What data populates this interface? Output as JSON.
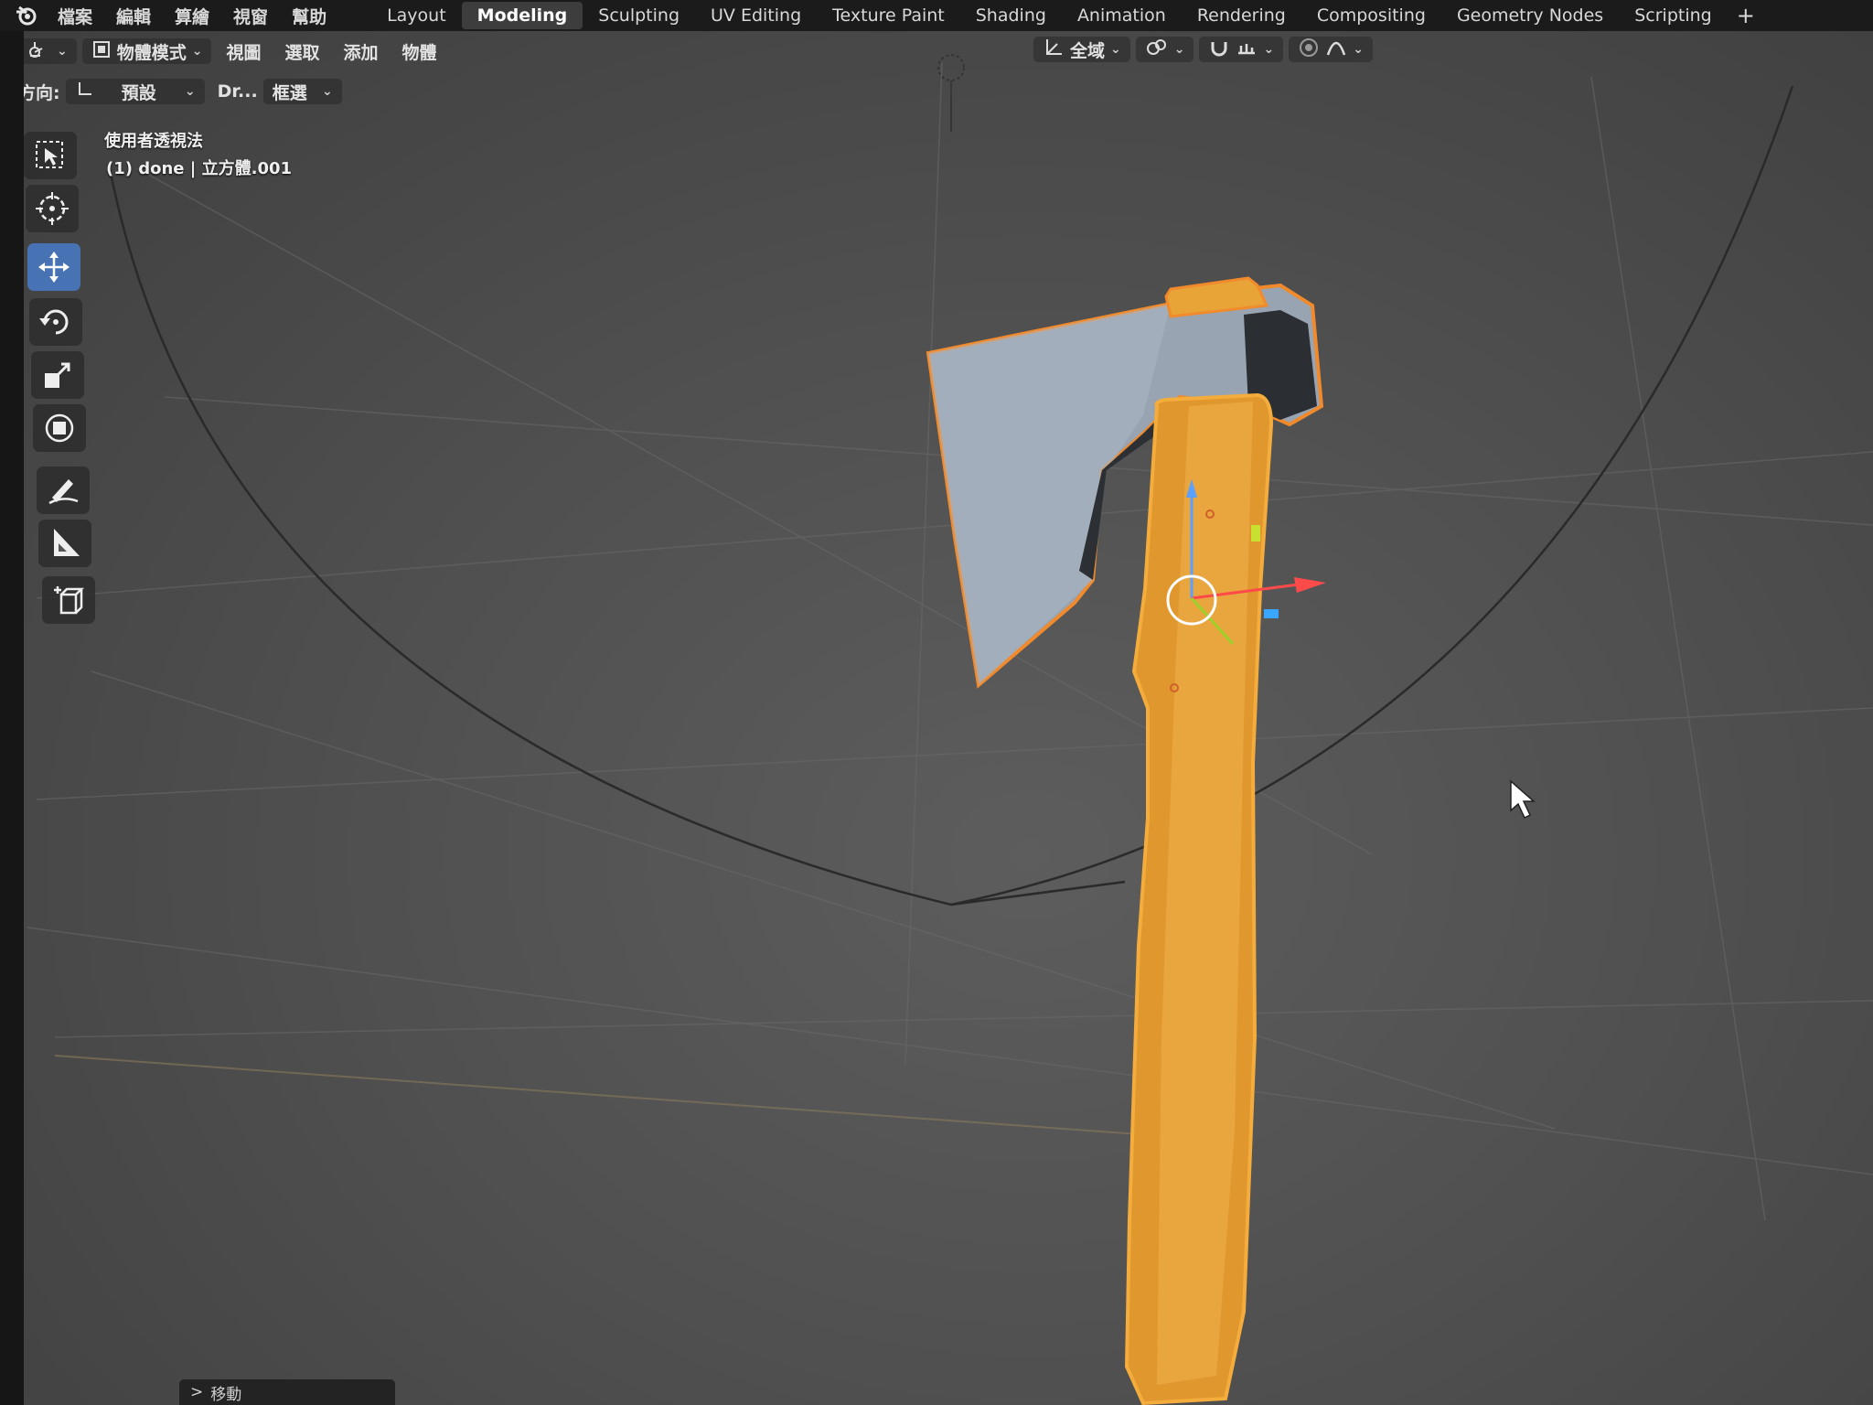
{
  "topbar": {
    "menus": [
      "檔案",
      "編輯",
      "算繪",
      "視窗",
      "幫助"
    ],
    "tabs": [
      "Layout",
      "Modeling",
      "Sculpting",
      "UV Editing",
      "Texture Paint",
      "Shading",
      "Animation",
      "Rendering",
      "Compositing",
      "Geometry Nodes",
      "Scripting"
    ],
    "active_tab": "Modeling",
    "add_tab": "+"
  },
  "viewport_header": {
    "mode": "物體模式",
    "menus": [
      "視圖",
      "選取",
      "添加",
      "物體"
    ],
    "transform_orientation": "全域"
  },
  "tool_settings": {
    "orientation_label": "方向:",
    "orientation_value": "預設",
    "drag_label": "Dr...",
    "select_mode": "框選"
  },
  "overlay": {
    "view_name": "使用者透視法",
    "object_info": "(1) done | 立方體.001"
  },
  "last_operator": {
    "arrow": ">",
    "label": "移動"
  },
  "toolbar": {
    "tools": [
      "select-box",
      "cursor",
      "move",
      "rotate",
      "scale",
      "transform",
      "annotate",
      "measure",
      "add-cube"
    ],
    "active_tool": "move"
  },
  "colors": {
    "accent": "#4772b3",
    "selection_outline": "#f08a2c",
    "handle_wood": "#e8a43a",
    "blade_steel": "#9aa6b2"
  }
}
